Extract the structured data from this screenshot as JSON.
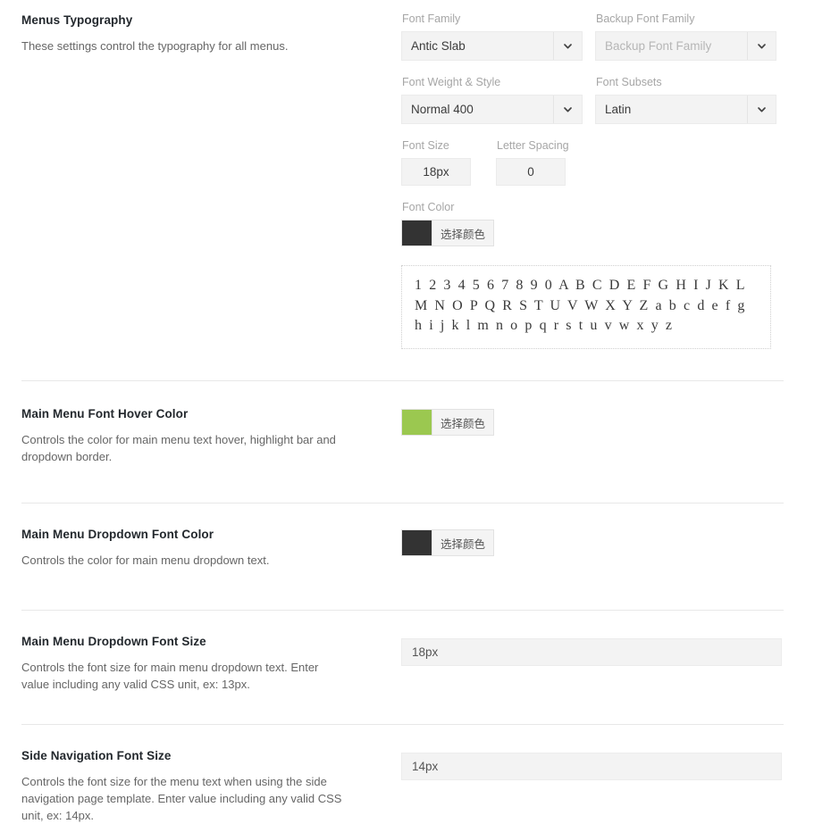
{
  "sections": [
    {
      "title": "Menus Typography",
      "description": "These settings control the typography for all menus.",
      "typography": {
        "font_family": {
          "label": "Font Family",
          "value": "Antic Slab"
        },
        "backup_font_family": {
          "label": "Backup Font Family",
          "value": "",
          "placeholder": "Backup Font Family"
        },
        "font_weight_style": {
          "label": "Font Weight & Style",
          "value": "Normal 400"
        },
        "font_subsets": {
          "label": "Font Subsets",
          "value": "Latin"
        },
        "font_size": {
          "label": "Font Size",
          "value": "18px"
        },
        "letter_spacing": {
          "label": "Letter Spacing",
          "value": "0"
        },
        "font_color": {
          "label": "Font Color",
          "value": "#333333",
          "button_label": "选择颜色"
        },
        "preview_text": "1 2 3 4 5 6 7 8 9 0 A B C D E F G H I J K L M N O P Q R S T U V W X Y Z a b c d e f g h i j k l m n o p q r s t u v w x y z"
      }
    },
    {
      "title": "Main Menu Font Hover Color",
      "description": "Controls the color for main menu text hover, highlight bar and dropdown border.",
      "color": {
        "value": "#9BC850",
        "button_label": "选择颜色"
      }
    },
    {
      "title": "Main Menu Dropdown Font Color",
      "description": "Controls the color for main menu dropdown text.",
      "color": {
        "value": "#333333",
        "button_label": "选择颜色"
      }
    },
    {
      "title": "Main Menu Dropdown Font Size",
      "description": "Controls the font size for main menu dropdown text. Enter value including any valid CSS unit, ex: 13px.",
      "input": {
        "value": "18px"
      }
    },
    {
      "title": "Side Navigation Font Size",
      "description": "Controls the font size for the menu text when using the side navigation page template. Enter value including any valid CSS unit, ex: 14px.",
      "input": {
        "value": "14px"
      }
    }
  ]
}
